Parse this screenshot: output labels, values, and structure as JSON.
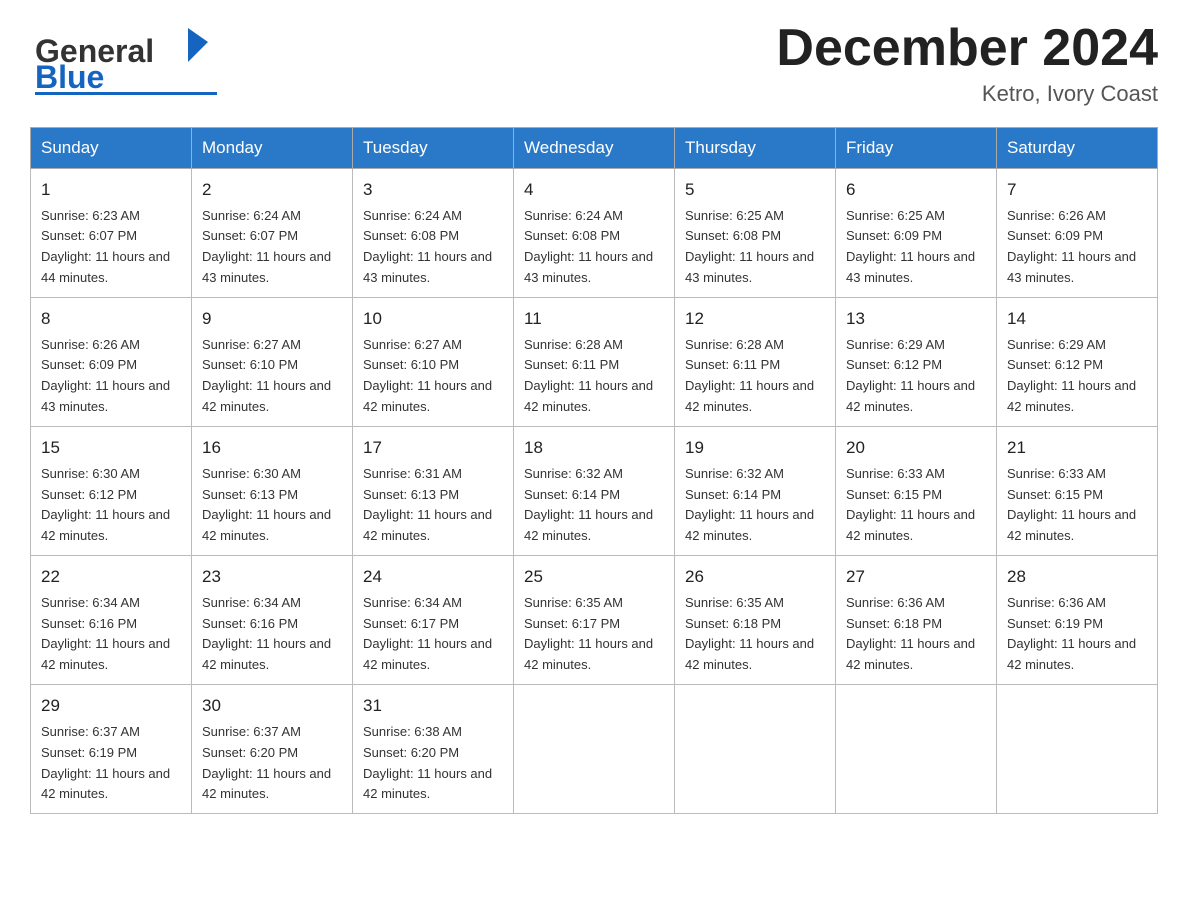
{
  "header": {
    "logo": {
      "general": "General",
      "blue": "Blue"
    },
    "title": "December 2024",
    "location": "Ketro, Ivory Coast"
  },
  "calendar": {
    "weekdays": [
      "Sunday",
      "Monday",
      "Tuesday",
      "Wednesday",
      "Thursday",
      "Friday",
      "Saturday"
    ],
    "weeks": [
      [
        {
          "day": 1,
          "sunrise": "6:23 AM",
          "sunset": "6:07 PM",
          "daylight": "11 hours and 44 minutes."
        },
        {
          "day": 2,
          "sunrise": "6:24 AM",
          "sunset": "6:07 PM",
          "daylight": "11 hours and 43 minutes."
        },
        {
          "day": 3,
          "sunrise": "6:24 AM",
          "sunset": "6:08 PM",
          "daylight": "11 hours and 43 minutes."
        },
        {
          "day": 4,
          "sunrise": "6:24 AM",
          "sunset": "6:08 PM",
          "daylight": "11 hours and 43 minutes."
        },
        {
          "day": 5,
          "sunrise": "6:25 AM",
          "sunset": "6:08 PM",
          "daylight": "11 hours and 43 minutes."
        },
        {
          "day": 6,
          "sunrise": "6:25 AM",
          "sunset": "6:09 PM",
          "daylight": "11 hours and 43 minutes."
        },
        {
          "day": 7,
          "sunrise": "6:26 AM",
          "sunset": "6:09 PM",
          "daylight": "11 hours and 43 minutes."
        }
      ],
      [
        {
          "day": 8,
          "sunrise": "6:26 AM",
          "sunset": "6:09 PM",
          "daylight": "11 hours and 43 minutes."
        },
        {
          "day": 9,
          "sunrise": "6:27 AM",
          "sunset": "6:10 PM",
          "daylight": "11 hours and 42 minutes."
        },
        {
          "day": 10,
          "sunrise": "6:27 AM",
          "sunset": "6:10 PM",
          "daylight": "11 hours and 42 minutes."
        },
        {
          "day": 11,
          "sunrise": "6:28 AM",
          "sunset": "6:11 PM",
          "daylight": "11 hours and 42 minutes."
        },
        {
          "day": 12,
          "sunrise": "6:28 AM",
          "sunset": "6:11 PM",
          "daylight": "11 hours and 42 minutes."
        },
        {
          "day": 13,
          "sunrise": "6:29 AM",
          "sunset": "6:12 PM",
          "daylight": "11 hours and 42 minutes."
        },
        {
          "day": 14,
          "sunrise": "6:29 AM",
          "sunset": "6:12 PM",
          "daylight": "11 hours and 42 minutes."
        }
      ],
      [
        {
          "day": 15,
          "sunrise": "6:30 AM",
          "sunset": "6:12 PM",
          "daylight": "11 hours and 42 minutes."
        },
        {
          "day": 16,
          "sunrise": "6:30 AM",
          "sunset": "6:13 PM",
          "daylight": "11 hours and 42 minutes."
        },
        {
          "day": 17,
          "sunrise": "6:31 AM",
          "sunset": "6:13 PM",
          "daylight": "11 hours and 42 minutes."
        },
        {
          "day": 18,
          "sunrise": "6:32 AM",
          "sunset": "6:14 PM",
          "daylight": "11 hours and 42 minutes."
        },
        {
          "day": 19,
          "sunrise": "6:32 AM",
          "sunset": "6:14 PM",
          "daylight": "11 hours and 42 minutes."
        },
        {
          "day": 20,
          "sunrise": "6:33 AM",
          "sunset": "6:15 PM",
          "daylight": "11 hours and 42 minutes."
        },
        {
          "day": 21,
          "sunrise": "6:33 AM",
          "sunset": "6:15 PM",
          "daylight": "11 hours and 42 minutes."
        }
      ],
      [
        {
          "day": 22,
          "sunrise": "6:34 AM",
          "sunset": "6:16 PM",
          "daylight": "11 hours and 42 minutes."
        },
        {
          "day": 23,
          "sunrise": "6:34 AM",
          "sunset": "6:16 PM",
          "daylight": "11 hours and 42 minutes."
        },
        {
          "day": 24,
          "sunrise": "6:34 AM",
          "sunset": "6:17 PM",
          "daylight": "11 hours and 42 minutes."
        },
        {
          "day": 25,
          "sunrise": "6:35 AM",
          "sunset": "6:17 PM",
          "daylight": "11 hours and 42 minutes."
        },
        {
          "day": 26,
          "sunrise": "6:35 AM",
          "sunset": "6:18 PM",
          "daylight": "11 hours and 42 minutes."
        },
        {
          "day": 27,
          "sunrise": "6:36 AM",
          "sunset": "6:18 PM",
          "daylight": "11 hours and 42 minutes."
        },
        {
          "day": 28,
          "sunrise": "6:36 AM",
          "sunset": "6:19 PM",
          "daylight": "11 hours and 42 minutes."
        }
      ],
      [
        {
          "day": 29,
          "sunrise": "6:37 AM",
          "sunset": "6:19 PM",
          "daylight": "11 hours and 42 minutes."
        },
        {
          "day": 30,
          "sunrise": "6:37 AM",
          "sunset": "6:20 PM",
          "daylight": "11 hours and 42 minutes."
        },
        {
          "day": 31,
          "sunrise": "6:38 AM",
          "sunset": "6:20 PM",
          "daylight": "11 hours and 42 minutes."
        },
        null,
        null,
        null,
        null
      ]
    ]
  }
}
